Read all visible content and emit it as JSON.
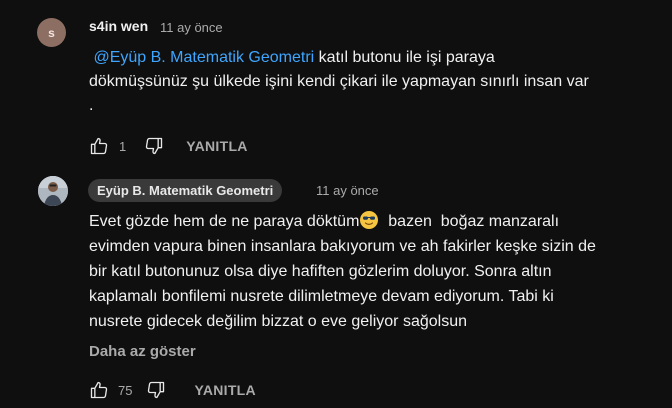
{
  "comment": {
    "avatar_letter": "s",
    "author": "s4in wen",
    "time": "11 ay önce",
    "mention": "@Eyüp B. Matematik Geometri",
    "text_line1": " katıl butonu ile işi paraya",
    "text_line2": "dökmüşsünüz şu ülkede işini kendi çikari ile yapmayan sınırlı insan var",
    "text_line3": ".",
    "likes": "1",
    "reply_label": "YANITLA"
  },
  "reply": {
    "author": "Eyüp B. Matematik Geometri",
    "time": "11 ay önce",
    "text_before_emoji": "Evet gözde hem de ne paraya döktüm",
    "text_line1_after": "  bazen  boğaz manzaralı",
    "text_line2": "evimden vapura binen insanlara bakıyorum ve ah fakirler keşke sizin de",
    "text_line3": "bir katıl butonunuz olsa diye hafiften gözlerim doluyor. Sonra altın",
    "text_line4": "kaplamalı bonfilemi nusrete dilimletmeye devam ediyorum. Tabi ki",
    "text_line5": "nusrete gidecek değilim bizzat o eve geliyor sağolsun",
    "show_less_label": "Daha az göster",
    "likes": "75",
    "reply_label": "YANITLA"
  },
  "icons": {
    "like": "thumbs-up-icon",
    "dislike": "thumbs-down-icon",
    "emoji": "smiling-face-with-sunglasses-emoji"
  }
}
